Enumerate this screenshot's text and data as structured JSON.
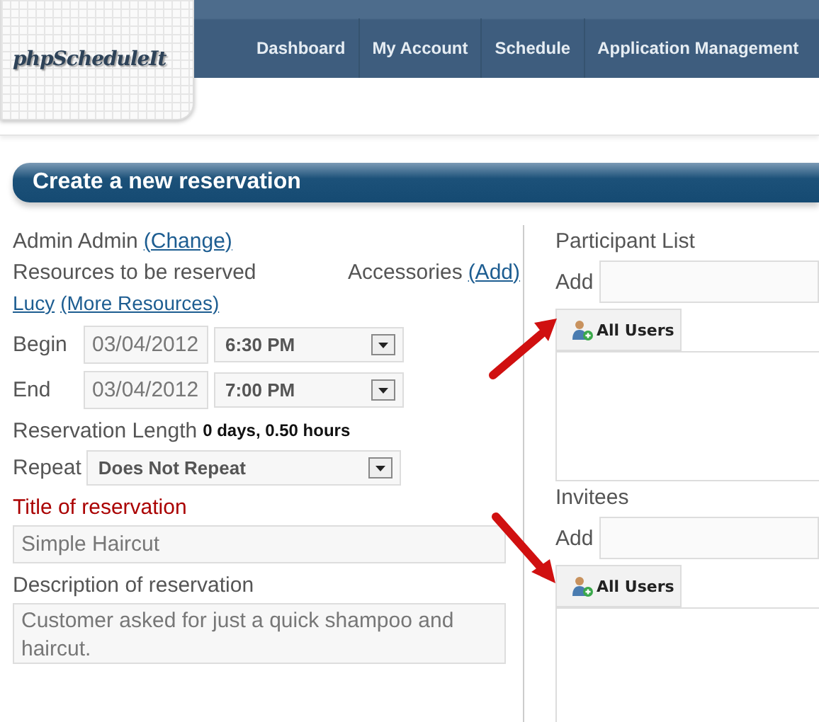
{
  "logo": "phpScheduleIt",
  "nav": [
    {
      "label": "Dashboard"
    },
    {
      "label": "My Account"
    },
    {
      "label": "Schedule"
    },
    {
      "label": "Application Management"
    }
  ],
  "page_title": "Create a new reservation",
  "form": {
    "owner": "Admin Admin",
    "change_link": "(Change)",
    "resources_label": "Resources to be reserved",
    "accessories_label": "Accessories",
    "accessories_link": "(Add)",
    "resource_link": "Lucy",
    "more_resources_link": "(More Resources)",
    "begin": {
      "label": "Begin",
      "date": "03/04/2012",
      "time": "6:30 PM"
    },
    "end": {
      "label": "End",
      "date": "03/04/2012",
      "time": "7:00 PM"
    },
    "length_label": "Reservation Length",
    "length_value": "0 days, 0.50 hours",
    "repeat": {
      "label": "Repeat",
      "value": "Does Not Repeat"
    },
    "title": {
      "label": "Title of reservation",
      "value": "Simple Haircut"
    },
    "description": {
      "label": "Description of reservation",
      "value": "Customer asked for just a quick shampoo and haircut."
    }
  },
  "people": [
    {
      "label": "Participant List",
      "add_label": "Add",
      "button": "All Users"
    },
    {
      "label": "Invitees",
      "add_label": "Add",
      "button": "All Users"
    }
  ]
}
